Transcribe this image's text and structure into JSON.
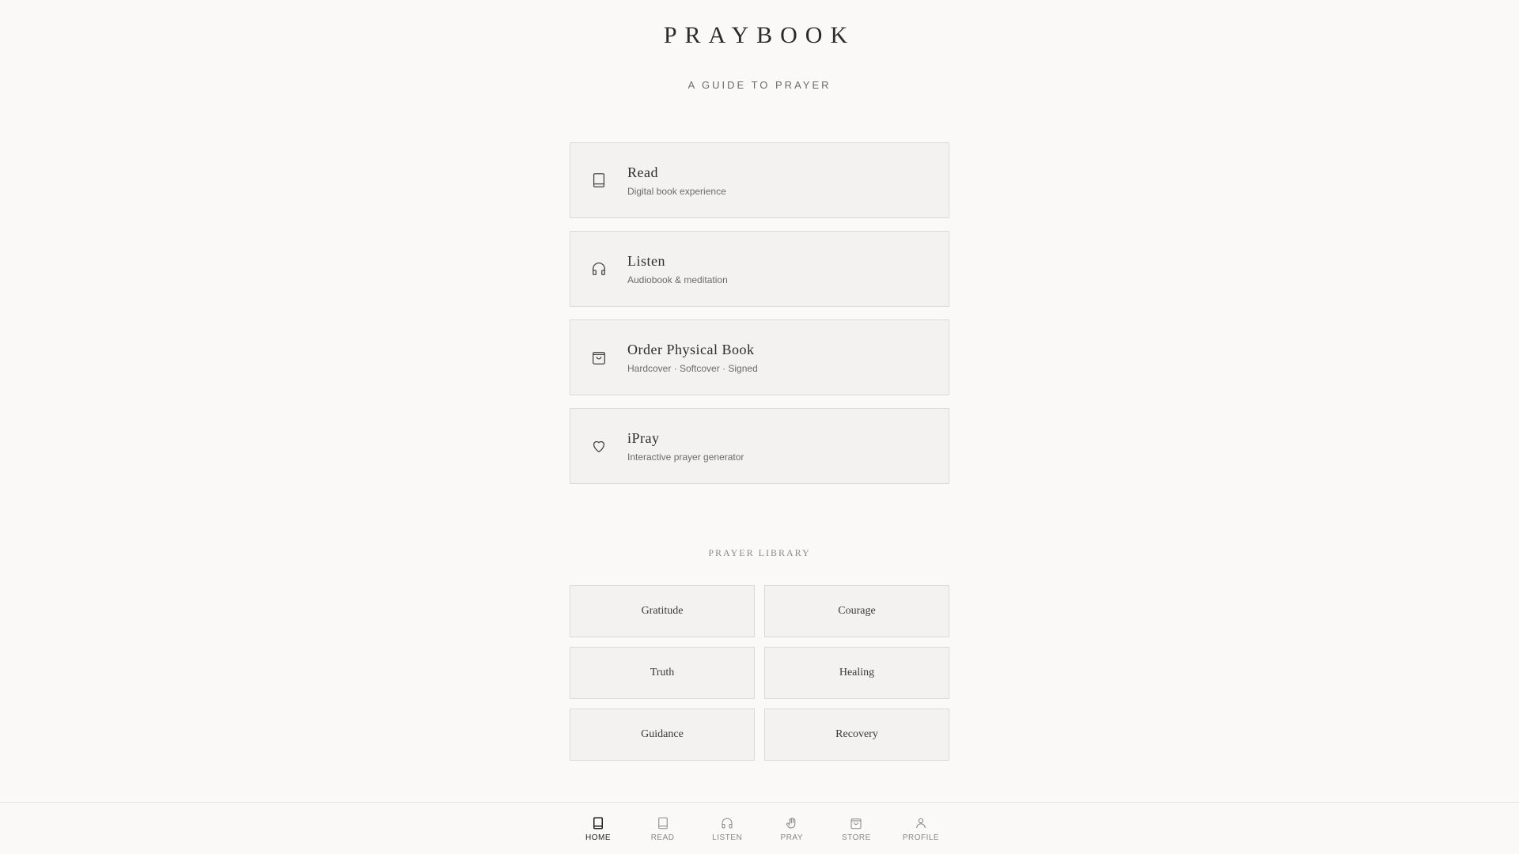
{
  "header": {
    "title": "PRAYBOOK",
    "tagline": "A GUIDE TO PRAYER"
  },
  "cards": [
    {
      "title": "Read",
      "subtitle": "Digital book experience",
      "icon": "book-icon"
    },
    {
      "title": "Listen",
      "subtitle": "Audiobook & meditation",
      "icon": "headphones-icon"
    },
    {
      "title": "Order Physical Book",
      "subtitle": "Hardcover · Softcover · Signed",
      "icon": "shopping-bag-icon"
    },
    {
      "title": "iPray",
      "subtitle": "Interactive prayer generator",
      "icon": "heart-icon"
    }
  ],
  "library": {
    "heading": "PRAYER LIBRARY",
    "items": [
      "Gratitude",
      "Courage",
      "Truth",
      "Healing",
      "Guidance",
      "Recovery"
    ]
  },
  "nav": {
    "items": [
      {
        "label": "HOME",
        "icon": "book-filled-icon",
        "active": true
      },
      {
        "label": "READ",
        "icon": "book-icon",
        "active": false
      },
      {
        "label": "LISTEN",
        "icon": "headphones-icon",
        "active": false
      },
      {
        "label": "PRAY",
        "icon": "praying-hand-icon",
        "active": false
      },
      {
        "label": "STORE",
        "icon": "shopping-bag-icon",
        "active": false
      },
      {
        "label": "PROFILE",
        "icon": "user-icon",
        "active": false
      }
    ]
  }
}
